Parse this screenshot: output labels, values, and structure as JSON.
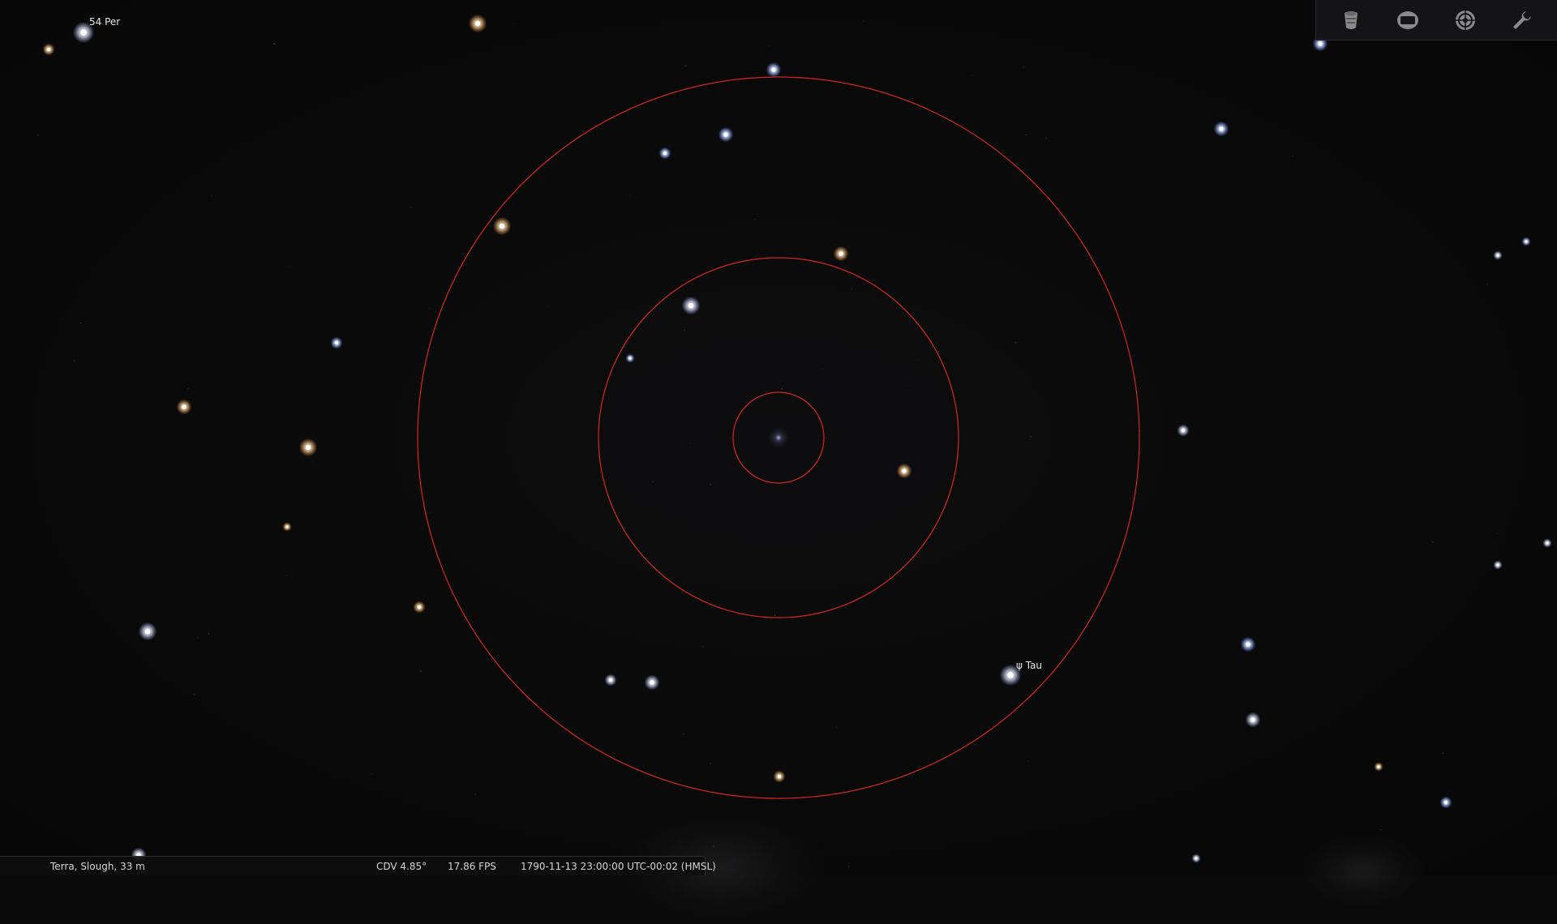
{
  "window": {
    "background": "#090909"
  },
  "labels": {
    "star_54_per": "54 Per",
    "star_psi_tau": "ψ Tau"
  },
  "toolbar": {
    "items": [
      {
        "name": "cylinder-icon"
      },
      {
        "name": "screen-icon"
      },
      {
        "name": "reticle-icon"
      },
      {
        "name": "wrench-icon"
      }
    ],
    "icon_color": "#8a8a8a"
  },
  "status": {
    "location": "Terra, Slough, 33 m",
    "fov": "CDV 4.85°",
    "fps": "17.86 FPS",
    "datetime": "1790-11-13 23:00:00 UTC-00:02 (HMSL)"
  },
  "overlay": {
    "circle_color": "#d42424"
  }
}
